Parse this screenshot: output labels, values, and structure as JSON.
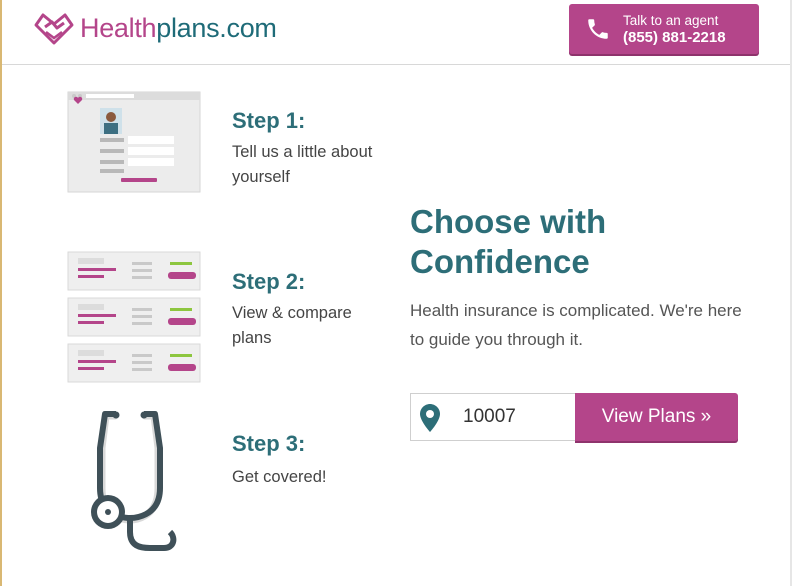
{
  "header": {
    "logo_brand": "Health",
    "logo_rest": "plans.com",
    "agent": {
      "line1": "Talk to an agent",
      "phone": "(855) 881-2218"
    }
  },
  "steps": [
    {
      "title": "Step 1:",
      "description": "Tell us a little about yourself"
    },
    {
      "title": "Step 2:",
      "description": "View & compare plans"
    },
    {
      "title": "Step 3:",
      "description": "Get covered!"
    }
  ],
  "hero": {
    "headline": "Choose with Confidence",
    "subtext": "Health insurance is complicated. We're here to guide you through it."
  },
  "search": {
    "zip_value": "10007",
    "button_label": "View Plans »"
  },
  "colors": {
    "brand_magenta": "#b4458a",
    "brand_teal": "#2d6e78"
  },
  "icons": [
    "heart-logo-icon",
    "phone-icon",
    "location-pin-icon",
    "stethoscope-icon"
  ]
}
